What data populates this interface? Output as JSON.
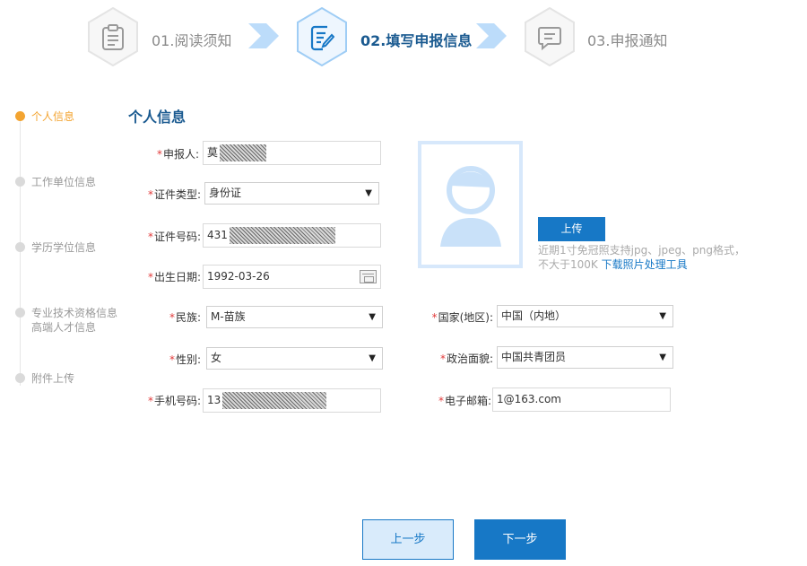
{
  "steps": [
    {
      "label": "01.阅读须知",
      "state": "done",
      "icon": "clipboard-icon"
    },
    {
      "label": "02.填写申报信息",
      "state": "active",
      "icon": "edit-document-icon"
    },
    {
      "label": "03.申报通知",
      "state": "pending",
      "icon": "message-icon"
    }
  ],
  "sidebar": {
    "items": [
      {
        "label": "个人信息",
        "active": true
      },
      {
        "label": "工作单位信息",
        "active": false
      },
      {
        "label": "学历学位信息",
        "active": false
      },
      {
        "label": "专业技术资格信息",
        "label2": "高端人才信息",
        "active": false
      },
      {
        "label": "附件上传",
        "active": false
      }
    ]
  },
  "form": {
    "title": "个人信息",
    "required_mark": "*",
    "applicant": {
      "label": "申报人:",
      "value": "莫"
    },
    "id_type": {
      "label": "证件类型:",
      "value": "身份证"
    },
    "id_number": {
      "label": "证件号码:",
      "value": "431"
    },
    "birth_date": {
      "label": "出生日期:",
      "value": "1992-03-26"
    },
    "ethnicity": {
      "label": "民族:",
      "value": "M-苗族"
    },
    "country": {
      "label": "国家(地区):",
      "value": "中国（内地）"
    },
    "gender": {
      "label": "性别:",
      "value": "女"
    },
    "political": {
      "label": "政治面貌:",
      "value": "中国共青团员"
    },
    "phone": {
      "label": "手机号码:",
      "value": "13"
    },
    "email": {
      "label": "电子邮箱:",
      "value": "1@163.com"
    },
    "dropdown_arrow": "▼"
  },
  "photo": {
    "upload_label": "上传",
    "hint_line1": "近期1寸免冠照支持jpg、jpeg、png格式，",
    "hint_line2": "不大于100K",
    "tool_link": "下载照片处理工具"
  },
  "buttons": {
    "prev": "上一步",
    "next": "下一步"
  },
  "colors": {
    "primary": "#1778c6",
    "active_title": "#1a5a90",
    "sidebar_active": "#f3a431",
    "required": "#e23b3b"
  }
}
